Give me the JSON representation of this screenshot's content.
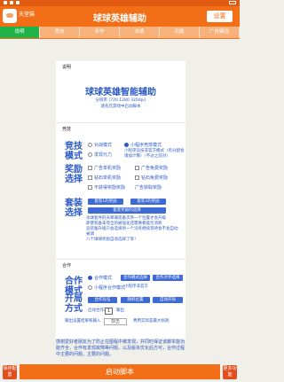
{
  "app": {
    "small_title": "天堂猫",
    "title": "球球英雄辅助",
    "settings": "设置"
  },
  "tabs": [
    "说明",
    "竞技",
    "合作",
    "冰境",
    "功能",
    "广告疑远"
  ],
  "intro": {
    "section": "说明",
    "heading": "球球英雄智能辅助",
    "res": "分辨率 (720 1280 320dpi)",
    "tip": "请先在游戏中启动脚本"
  },
  "jingji": {
    "section": "竞技",
    "mode_label_1": "竞技",
    "mode_label_2": "模式",
    "mode_opts": [
      "对战模式",
      "小程序竞技模式",
      "发现元力"
    ],
    "mode_note": "小程序竞技非官方模式（有分配会增加计算）（不过之前对）",
    "reward_label_1": "奖励",
    "reward_label_2": "选择",
    "reward_opts": [
      "广告单机奖励",
      "广告免费奖励",
      "钻石单机奖励",
      "钻石免费奖励",
      "不获得奖励奖励",
      "广告获取奖励"
    ],
    "team_label_1": "套装",
    "team_label_2": "选择",
    "team_btns": [
      "套装1的奖励",
      "套装2的奖励"
    ],
    "team_btn_wide": "套装奖励的选择",
    "notes": [
      "冰球套件的天梯满装备次序一个位置才会升级",
      "即使装备未完全的被强化还需要看能否消耗",
      "竞装备升级只会选择另一个没有继续等待会不会自动被调",
      "八个球球奖励自动选择了等！"
    ]
  },
  "hezuo": {
    "section": "合作",
    "mode_label_1": "合作",
    "mode_label_2": "模式",
    "mode_opts": [
      "合作模式",
      "小程序合作模式"
    ],
    "mode_btns": [
      "合作模式选择",
      "合作对手选择"
    ],
    "mode_note": "小程序非官方",
    "open_label_1": "开局",
    "open_label_2": "方式",
    "open_btns": [
      "合作队伍",
      "随机位置",
      "自动开局"
    ],
    "count_label": "启动合作次数",
    "count_value": "1",
    "count_unit": "输出",
    "detail_label": "输出设置结果和输入",
    "plan_btn": "双击",
    "plan_note": "费用实际是最大损耗"
  },
  "announcement": "感谢爱好者朋友为了防止在图程中被发现，并同时保证该脚本能功能齐全，合作有发现故障等问题，以及版本优化后方可，合作过程中主要的问题，主要的问题。",
  "bottom": {
    "left": "保存配置",
    "start": "启动脚本",
    "right": "更多功能"
  }
}
